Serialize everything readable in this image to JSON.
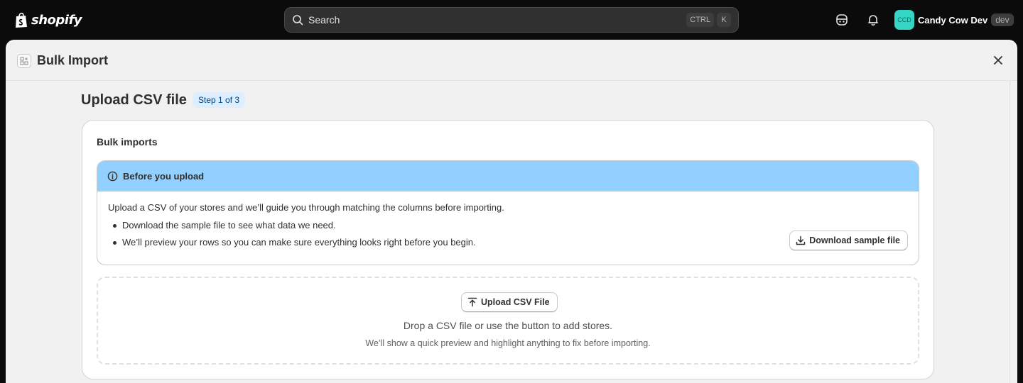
{
  "topbar": {
    "logo_text": "shopify",
    "search": {
      "placeholder": "Search",
      "shortcut_keys": [
        "CTRL",
        "K"
      ]
    },
    "account": {
      "avatar_initials": "CCD",
      "name": "Candy Cow Dev",
      "env_badge": "dev",
      "avatar_color": "#35d6c5"
    }
  },
  "modal": {
    "title": "Bulk Import",
    "page_title": "Upload CSV file",
    "step_badge": "Step 1 of 3",
    "card": {
      "title": "Bulk imports",
      "banner": {
        "title": "Before you upload",
        "description": "Upload a CSV of your stores and we’ll guide you through matching the columns before importing.",
        "bullets": [
          "Download the sample file to see what data we need.",
          "We’ll preview your rows so you can make sure everything looks right before you begin."
        ],
        "download_button": "Download sample file",
        "color": "#91d0ff"
      },
      "dropzone": {
        "upload_button": "Upload CSV File",
        "text": "Drop a CSV file or use the button to add stores.",
        "subtext": "We’ll show a quick preview and highlight anything to fix before importing."
      }
    }
  },
  "icons": [
    "shopify-bag-icon",
    "search-icon",
    "sidekick-icon",
    "bell-icon",
    "app-icon",
    "close-icon",
    "info-icon",
    "download-icon",
    "upload-icon"
  ]
}
